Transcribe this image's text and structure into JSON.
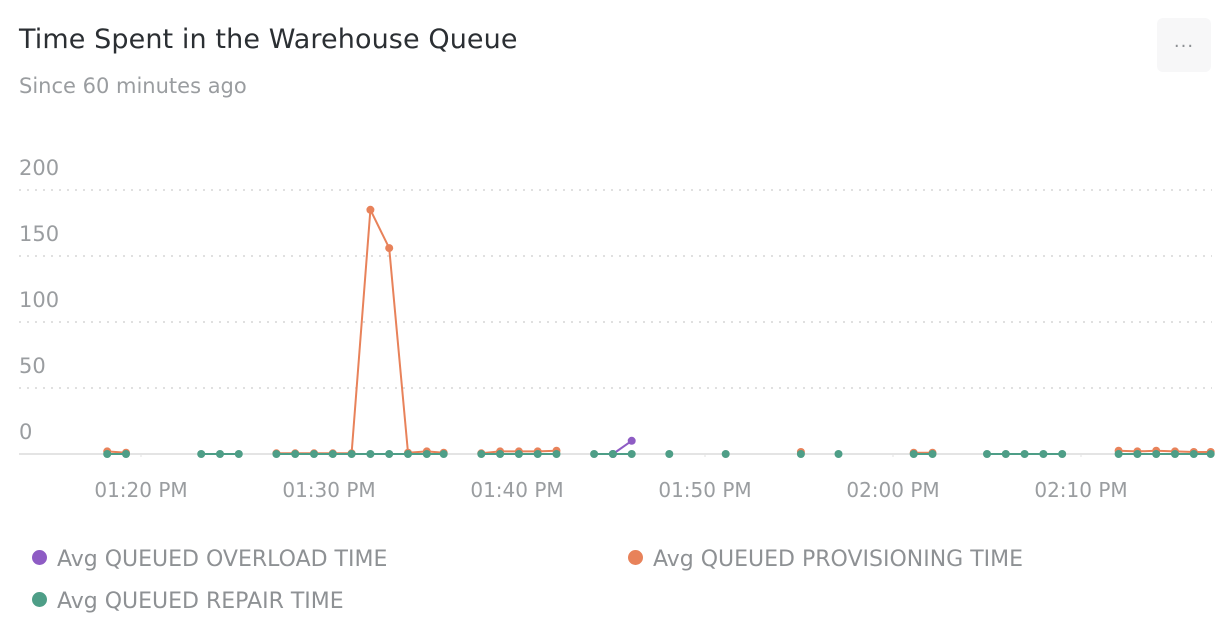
{
  "header": {
    "title": "Time Spent in the Warehouse Queue",
    "subtitle": "Since 60 minutes ago",
    "menu_label": "..."
  },
  "chart_data": {
    "type": "line",
    "title": "Time Spent in the Warehouse Queue",
    "subtitle": "Since 60 minutes ago",
    "xlabel": "",
    "ylabel": "",
    "x_unit": "minutes after 01:00 PM",
    "xlim": [
      13.5,
      79.0
    ],
    "ylim": [
      0,
      200
    ],
    "yticks": [
      0,
      50,
      100,
      150,
      200
    ],
    "ytick_labels": [
      "0",
      "50",
      "100",
      "150",
      "200"
    ],
    "xticks": [
      20,
      30,
      40,
      50,
      60,
      70
    ],
    "xtick_labels": [
      "01:20 PM",
      "01:30 PM",
      "01:40 PM",
      "01:50 PM",
      "02:00 PM",
      "02:10 PM"
    ],
    "grid": "horizontal-dotted",
    "legend_position": "bottom",
    "series": [
      {
        "name": "Avg QUEUED OVERLOAD TIME",
        "color": "#8e5cc4",
        "segments": [
          [
            [
              45.1,
              0
            ],
            [
              46.1,
              10
            ]
          ]
        ]
      },
      {
        "name": "Avg QUEUED PROVISIONING TIME",
        "color": "#e8825a",
        "segments": [
          [
            [
              18.2,
              2
            ],
            [
              19.2,
              1
            ]
          ],
          [
            [
              27.2,
              0.5
            ],
            [
              28.2,
              0.5
            ],
            [
              29.2,
              0.5
            ],
            [
              30.2,
              0.5
            ],
            [
              31.2,
              0.5
            ],
            [
              32.2,
              185
            ],
            [
              33.2,
              156
            ],
            [
              34.2,
              1
            ],
            [
              35.2,
              2
            ],
            [
              36.1,
              1
            ]
          ],
          [
            [
              38.1,
              0.5
            ],
            [
              39.1,
              2
            ],
            [
              40.1,
              2
            ],
            [
              41.1,
              2
            ],
            [
              42.1,
              2.5
            ]
          ],
          [
            [
              55.1,
              1.5
            ]
          ],
          [
            [
              61.1,
              1
            ],
            [
              62.1,
              1
            ]
          ],
          [
            [
              72.0,
              2.5
            ],
            [
              73.0,
              2
            ],
            [
              74.0,
              2.5
            ],
            [
              75.0,
              2
            ],
            [
              76.0,
              1.5
            ],
            [
              76.9,
              1.5
            ]
          ]
        ]
      },
      {
        "name": "Avg QUEUED REPAIR TIME",
        "color": "#4e9e87",
        "segments": [
          [
            [
              18.2,
              0
            ],
            [
              19.2,
              0
            ]
          ],
          [
            [
              23.2,
              0
            ],
            [
              24.2,
              0
            ],
            [
              25.2,
              0
            ]
          ],
          [
            [
              27.2,
              0
            ],
            [
              28.2,
              0
            ],
            [
              29.2,
              0
            ],
            [
              30.2,
              0
            ],
            [
              31.2,
              0
            ],
            [
              32.2,
              0
            ],
            [
              33.2,
              0
            ],
            [
              34.2,
              0
            ],
            [
              35.2,
              0
            ],
            [
              36.1,
              0
            ]
          ],
          [
            [
              38.1,
              0
            ],
            [
              39.1,
              0
            ],
            [
              40.1,
              0
            ],
            [
              41.1,
              0
            ],
            [
              42.1,
              0
            ]
          ],
          [
            [
              44.1,
              0
            ],
            [
              45.1,
              0
            ],
            [
              46.1,
              0
            ]
          ],
          [
            [
              48.1,
              0
            ]
          ],
          [
            [
              51.1,
              0
            ]
          ],
          [
            [
              55.1,
              0
            ]
          ],
          [
            [
              57.1,
              0
            ]
          ],
          [
            [
              61.1,
              0
            ],
            [
              62.1,
              0
            ]
          ],
          [
            [
              65.0,
              0
            ],
            [
              66.0,
              0
            ],
            [
              67.0,
              0
            ],
            [
              68.0,
              0
            ],
            [
              69.0,
              0
            ]
          ],
          [
            [
              72.0,
              0
            ],
            [
              73.0,
              0
            ],
            [
              74.0,
              0
            ],
            [
              75.0,
              0
            ],
            [
              76.0,
              0
            ],
            [
              76.9,
              0
            ]
          ]
        ]
      }
    ]
  },
  "legend": [
    {
      "label": "Avg QUEUED OVERLOAD TIME",
      "color": "#8e5cc4"
    },
    {
      "label": "Avg QUEUED PROVISIONING TIME",
      "color": "#e8825a"
    },
    {
      "label": "Avg QUEUED REPAIR TIME",
      "color": "#4e9e87"
    }
  ]
}
